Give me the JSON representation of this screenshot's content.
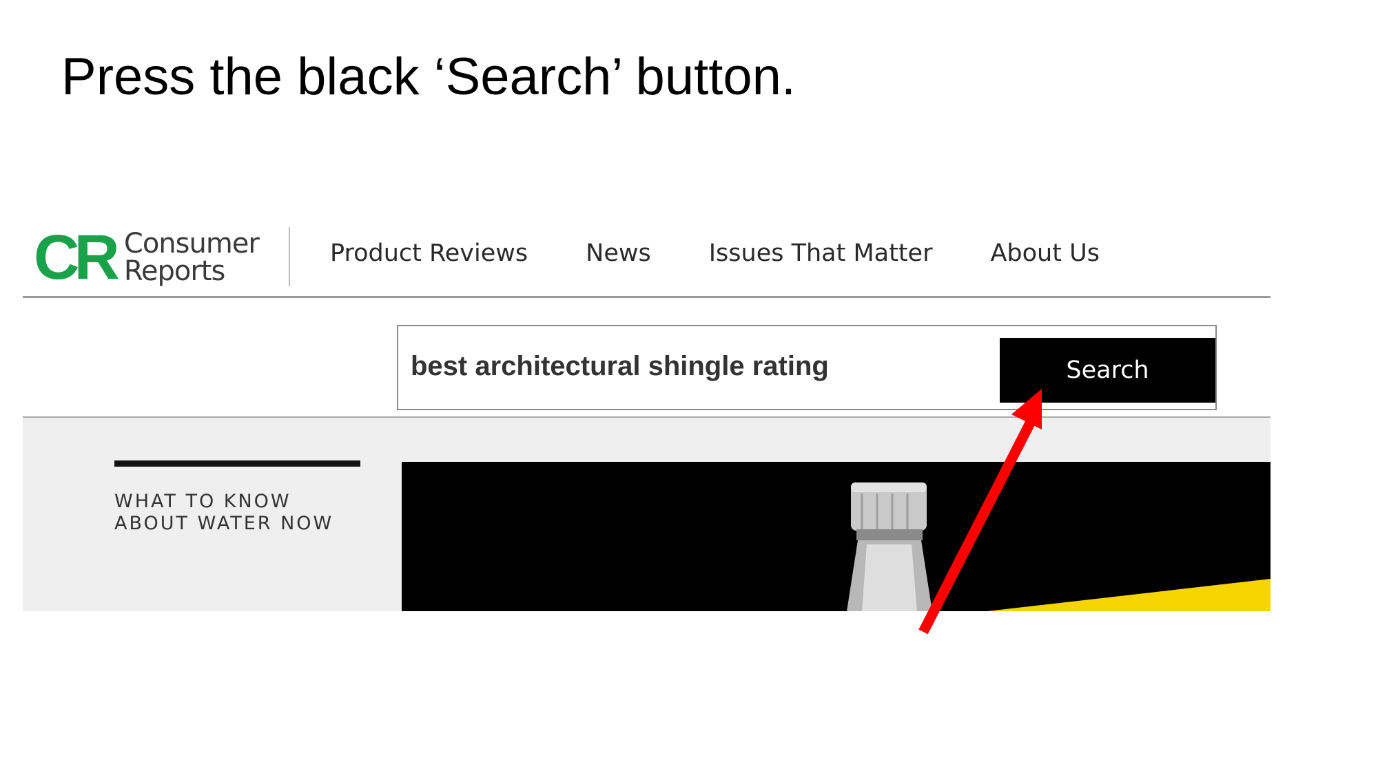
{
  "instruction": "Press the black ‘Search’ button.",
  "logo": {
    "mark": "CR",
    "line1": "Consumer",
    "line2": "Reports"
  },
  "nav": {
    "items": [
      "Product Reviews",
      "News",
      "Issues That Matter",
      "About Us"
    ]
  },
  "search": {
    "value": "best architectural shingle rating",
    "button_label": "Search"
  },
  "feature": {
    "headline": "WHAT TO KNOW ABOUT WATER NOW"
  },
  "colors": {
    "brand_green": "#1aa24a",
    "button_bg": "#000000",
    "arrow": "#ff0000",
    "accent_yellow": "#f6d400"
  }
}
